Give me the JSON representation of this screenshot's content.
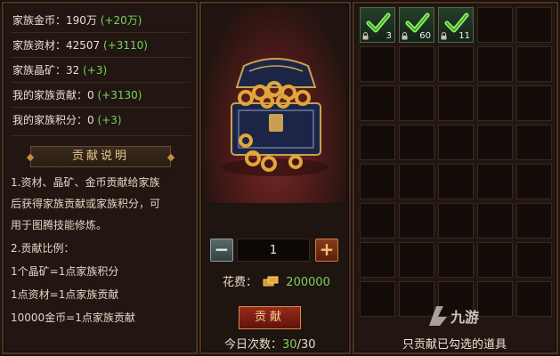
{
  "stats": [
    {
      "label": "家族金币：190万",
      "bonus": "(+20万)"
    },
    {
      "label": "家族资材：42507",
      "bonus": "(+3110)"
    },
    {
      "label": "家族晶矿：32",
      "bonus": "(+3)"
    },
    {
      "label": "我的家族贡献：0",
      "bonus": "(+3130)"
    },
    {
      "label": "我的家族积分：0",
      "bonus": "(+3)"
    }
  ],
  "description": {
    "title": "贡献说明",
    "lines": [
      "1.资材、晶矿、金币贡献给家族",
      "后获得家族贡献或家族积分，可",
      "用于图腾技能修炼。",
      "2.贡献比例：",
      "1个晶矿=1点家族积分",
      "1点资材=1点家族贡献",
      "10000金币=1点家族贡献"
    ]
  },
  "exchange": {
    "minus": "−",
    "plus": "+",
    "quantity": "1",
    "cost_label": "花费：",
    "cost_value": "200000",
    "contribute_label": "贡献",
    "times_label": "今日次数：",
    "times_used": "30",
    "times_total": "/30"
  },
  "inventory": {
    "items": [
      {
        "icon": "check-icon",
        "count": "3"
      },
      {
        "icon": "check-icon",
        "count": "60"
      },
      {
        "icon": "check-icon",
        "count": "11"
      }
    ],
    "total_slots": 40,
    "hint": "只贡献已勾选的道具"
  },
  "watermark": "九游",
  "colors": {
    "bonus": "#79d25e",
    "accent": "#e6c98c"
  }
}
